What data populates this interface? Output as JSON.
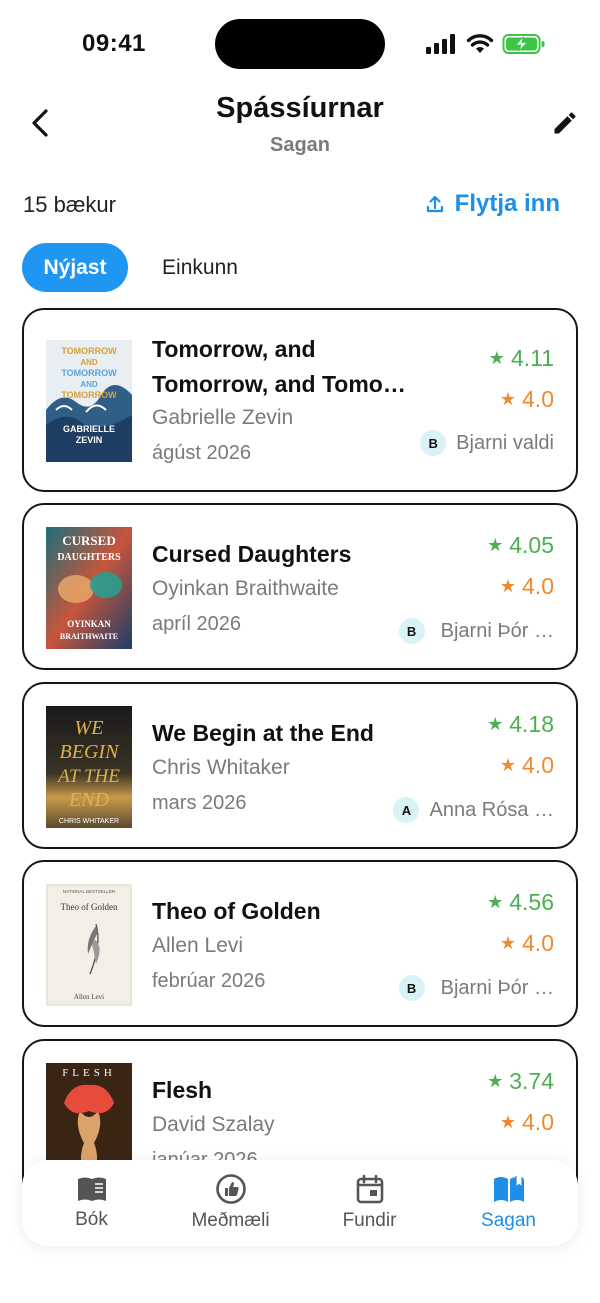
{
  "status": {
    "time": "09:41"
  },
  "header": {
    "title": "Spássíurnar",
    "subtitle": "Sagan"
  },
  "toolbar": {
    "count_label": "15 bækur",
    "import_label": "Flytja inn"
  },
  "sort": {
    "active": "Nýjast",
    "inactive": "Einkunn"
  },
  "books": [
    {
      "title": "Tomorrow, and Tomorrow, and Tomo…",
      "author": "Gabrielle Zevin",
      "date": "ágúst 2026",
      "rating_green": "4.11",
      "rating_orange": "4.0",
      "avatar": "B",
      "chooser": "Bjarni valdi"
    },
    {
      "title": "Cursed Daughters",
      "author": "Oyinkan Braithwaite",
      "date": "apríl 2026",
      "rating_green": "4.05",
      "rating_orange": "4.0",
      "avatar": "B",
      "chooser": "Bjarni Þór …"
    },
    {
      "title": "We Begin at the End",
      "author": "Chris Whitaker",
      "date": "mars 2026",
      "rating_green": "4.18",
      "rating_orange": "4.0",
      "avatar": "A",
      "chooser": "Anna Rósa …"
    },
    {
      "title": "Theo of Golden",
      "author": "Allen Levi",
      "date": "febrúar 2026",
      "rating_green": "4.56",
      "rating_orange": "4.0",
      "avatar": "B",
      "chooser": "Bjarni Þór …"
    },
    {
      "title": "Flesh",
      "author": "David Szalay",
      "date": "janúar 2026",
      "rating_green": "3.74",
      "rating_orange": "4.0"
    }
  ],
  "covers": [
    {
      "lines": [
        "TOMORROW",
        "AND",
        "TOMORROW",
        "AND",
        "TOMORROW",
        "GABRIELLE",
        "ZEVIN"
      ]
    },
    {
      "lines": [
        "CURSED",
        "DAUGHTERS",
        "OYINKAN",
        "BRAITHWAITE"
      ]
    },
    {
      "lines": [
        "WE",
        "BEGIN",
        "AT THE",
        "END",
        "CHRIS WHITAKER"
      ]
    },
    {
      "lines": [
        "NATIONAL BESTSELLER",
        "Theo of Golden",
        "Allen Levi"
      ]
    },
    {
      "lines": [
        "FLESH"
      ]
    }
  ],
  "nav": [
    {
      "label": "Bók",
      "icon": "book-icon"
    },
    {
      "label": "Meðmæli",
      "icon": "thumbs-up-icon"
    },
    {
      "label": "Fundir",
      "icon": "calendar-icon"
    },
    {
      "label": "Sagan",
      "icon": "open-book-icon",
      "active": true
    }
  ],
  "colors": {
    "accent": "#2096f3",
    "rating_green": "#4caf50",
    "rating_orange": "#ef8a33",
    "avatar_bg": "#d8f2f6"
  }
}
